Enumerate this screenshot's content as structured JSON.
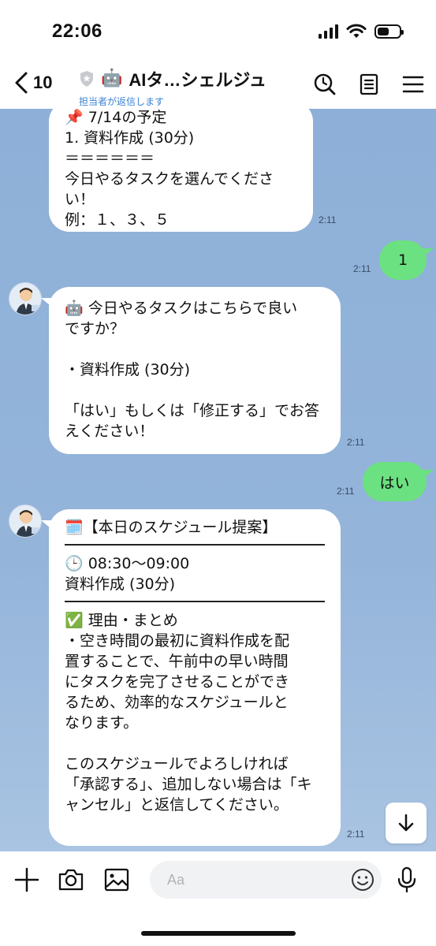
{
  "status_bar": {
    "time": "22:06"
  },
  "header": {
    "back_count": "10",
    "robot_emoji": "🤖",
    "title": "AIタ…シェルジュ",
    "subtitle": "担当者が返信します"
  },
  "messages": {
    "m1": {
      "lines": [
        "📌 7/14の予定",
        "1. 資料作成 (30分)",
        "＝＝＝＝＝＝",
        "今日やるタスクを選んでくださ",
        "い！",
        "例：１、３、５"
      ],
      "time": "2:11"
    },
    "m2": {
      "text": "1",
      "time": "2:11"
    },
    "m3": {
      "lines": [
        "🤖 今日やるタスクはこちらで良い",
        "ですか？",
        " ",
        "・資料作成 (30分)",
        " ",
        "「はい」もしくは「修正する」でお答",
        "えください！"
      ],
      "time": "2:11"
    },
    "m4": {
      "text": "はい",
      "time": "2:11"
    },
    "m5": {
      "heading": "🗓️【本日のスケジュール提案】",
      "slot_time": "🕒 08:30～09:00",
      "slot_task": "資料作成 (30分)",
      "reason_heading": "✅ 理由・まとめ",
      "reason_lines": [
        "・空き時間の最初に資料作成を配",
        "置することで、午前中の早い時間",
        "にタスクを完了させることができ",
        "るため、効率的なスケジュールと",
        "なります。",
        " ",
        "このスケジュールでよろしければ",
        "「承認する」、追加しない場合は「キ",
        "ャンセル」と返信してください。"
      ],
      "time": "2:11"
    }
  },
  "input": {
    "placeholder": "Aa"
  },
  "colors": {
    "chat_bg": "#8eb0d8",
    "outgoing_bubble": "#6be181",
    "subtitle": "#3b82d6"
  }
}
